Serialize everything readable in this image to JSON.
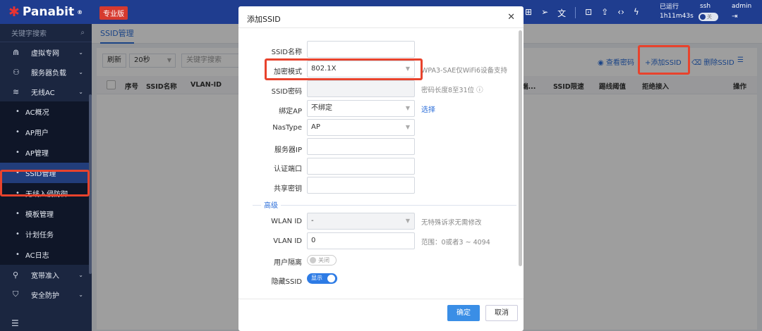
{
  "topbar": {
    "brand": "Panabit",
    "brand_mark": "®",
    "edition": "专业版",
    "runtime_label": "已运行",
    "runtime_value": "1h11m43s",
    "ssh_label": "ssh",
    "ssh_toggle": "关",
    "user": "admin",
    "icons": [
      "book-icon",
      "send-icon",
      "translate-icon",
      "grid-icon",
      "upload-icon",
      "code-icon",
      "bolt-icon"
    ]
  },
  "sidebar": {
    "search_placeholder": "关键字搜索",
    "sections": [
      {
        "label": "虚拟专网",
        "icon": "network-icon"
      },
      {
        "label": "服务器负载",
        "icon": "server-icon"
      },
      {
        "label": "无线AC",
        "icon": "wifi-icon"
      }
    ],
    "ac_items": [
      "AC概况",
      "AP用户",
      "AP管理",
      "SSID管理",
      "无线入侵防御",
      "模板管理",
      "计划任务",
      "AC日志"
    ],
    "bottom_sections": [
      {
        "label": "宽带准入",
        "icon": "user-icon"
      },
      {
        "label": "安全防护",
        "icon": "shield-icon"
      }
    ]
  },
  "main": {
    "tab": "SSID管理",
    "toolbar": {
      "refresh": "刷新",
      "interval": "20秒",
      "search_placeholder": "关键字搜索",
      "view_password": "查看密码",
      "add_ssid": "+添加SSID",
      "delete_ssid": "删除SSID"
    },
    "columns": [
      "序号",
      "SSID名称",
      "VLAN-ID",
      "终端",
      "SSID限速",
      "踢线阈值",
      "拒绝接入",
      "操作"
    ],
    "col_partial": "端..."
  },
  "modal": {
    "title": "添加SSID",
    "fields": {
      "ssid_name": {
        "label": "SSID名称",
        "value": ""
      },
      "enc_mode": {
        "label": "加密模式",
        "value": "802.1X",
        "hint": "WPA3-SAE仅WiFi6设备支持"
      },
      "ssid_pwd": {
        "label": "SSID密码",
        "value": "",
        "hint": "密码长度8至31位"
      },
      "bind_ap": {
        "label": "绑定AP",
        "value": "不绑定",
        "link": "选择"
      },
      "nastype": {
        "label": "NasType",
        "value": "AP"
      },
      "server_ip": {
        "label": "服务器IP",
        "value": ""
      },
      "auth_port": {
        "label": "认证端口",
        "value": ""
      },
      "shared_key": {
        "label": "共享密钥",
        "value": ""
      }
    },
    "advanced_label": "高级",
    "advanced": {
      "wlan_id": {
        "label": "WLAN ID",
        "value": "-",
        "hint": "无特殊诉求无需修改"
      },
      "vlan_id": {
        "label": "VLAN ID",
        "value": "0",
        "hint": "范围：0或者3 ~ 4094"
      },
      "user_isolation": {
        "label": "用户隔离",
        "state": "关闭"
      },
      "hide_ssid": {
        "label": "隐藏SSID",
        "state": "显示"
      }
    },
    "ok": "确定",
    "cancel": "取消"
  },
  "colors": {
    "topbar": "#1f3d8f",
    "sidebar": "#1b2640",
    "accent": "#2d6fd9",
    "highlight": "#e8432d",
    "edition_badge": "#d63a2f"
  }
}
